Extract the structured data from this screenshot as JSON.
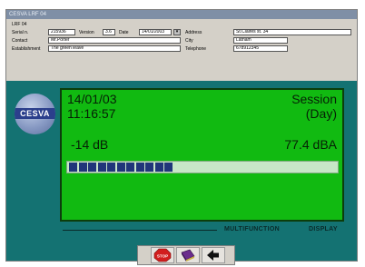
{
  "window": {
    "title": "CESVA LRF 04"
  },
  "info_left": [
    {
      "label": "LRF 04",
      "value": ""
    },
    {
      "label": "Serial n.",
      "value": "215936"
    },
    {
      "label": "Contact",
      "value": "Mr.Porter"
    },
    {
      "label": "Establishment",
      "value": "The green leave"
    }
  ],
  "version": {
    "label": "Version",
    "value": "3.6"
  },
  "date_field": {
    "label": "Date",
    "value": "14/01/2003"
  },
  "info_right": [
    {
      "label": "Address",
      "value": "St.Claires st. 34"
    },
    {
      "label": "City",
      "value": "Latham"
    },
    {
      "label": "Telephone",
      "value": "678912345"
    }
  ],
  "logo": {
    "text": "CESVA"
  },
  "display": {
    "date": "14/01/03",
    "time": "11:16:57",
    "mode_line1": "Session",
    "mode_line2": "(Day)",
    "db_offset": "-14 dB",
    "level": "77.4 dBA",
    "bar_fill": 0.38,
    "bar_segments": 11
  },
  "footer": {
    "label1": "MULTIFUNCTION",
    "label2": "DISPLAY"
  },
  "buttons": [
    {
      "name": "stop-button",
      "icon": "stop-icon",
      "text": "STOP"
    },
    {
      "name": "book-button",
      "icon": "book-icon"
    },
    {
      "name": "exit-button",
      "icon": "arrow-left-icon"
    }
  ],
  "colors": {
    "screen_green": "#11ba11",
    "teal": "#147272",
    "bar_blue": "#20357a"
  }
}
